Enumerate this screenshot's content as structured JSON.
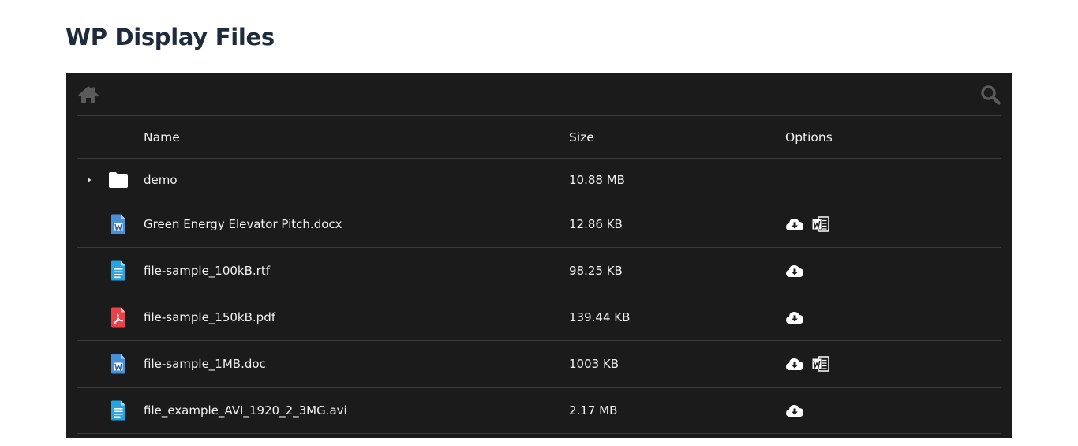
{
  "page": {
    "title": "WP Display Files"
  },
  "toolbar": {
    "home_icon": "home-icon",
    "search_icon": "search-icon"
  },
  "table": {
    "columns": {
      "name": "Name",
      "size": "Size",
      "options": "Options"
    },
    "rows": [
      {
        "name": "demo",
        "size": "10.88 MB",
        "type": "folder",
        "icon": "folder-icon",
        "options": []
      },
      {
        "name": "Green Energy Elevator Pitch.docx",
        "size": "12.86 KB",
        "type": "word",
        "icon": "word-file-icon",
        "options": [
          "download-icon",
          "word-icon"
        ]
      },
      {
        "name": "file-sample_100kB.rtf",
        "size": "98.25 KB",
        "type": "text",
        "icon": "text-file-icon",
        "options": [
          "download-icon"
        ]
      },
      {
        "name": "file-sample_150kB.pdf",
        "size": "139.44 KB",
        "type": "pdf",
        "icon": "pdf-file-icon",
        "options": [
          "download-icon"
        ]
      },
      {
        "name": "file-sample_1MB.doc",
        "size": "1003 KB",
        "type": "word",
        "icon": "word-file-icon",
        "options": [
          "download-icon",
          "word-icon"
        ]
      },
      {
        "name": "file_example_AVI_1920_2_3MG.avi",
        "size": "2.17 MB",
        "type": "text",
        "icon": "text-file-icon",
        "options": [
          "download-icon"
        ]
      }
    ]
  },
  "colors": {
    "panel_bg": "#1b1b1b",
    "row_border": "#3a3a3a",
    "title": "#1f2a3a",
    "word_blue": "#4a90d9",
    "text_blue": "#29a3e0",
    "pdf_red": "#e8424b"
  }
}
